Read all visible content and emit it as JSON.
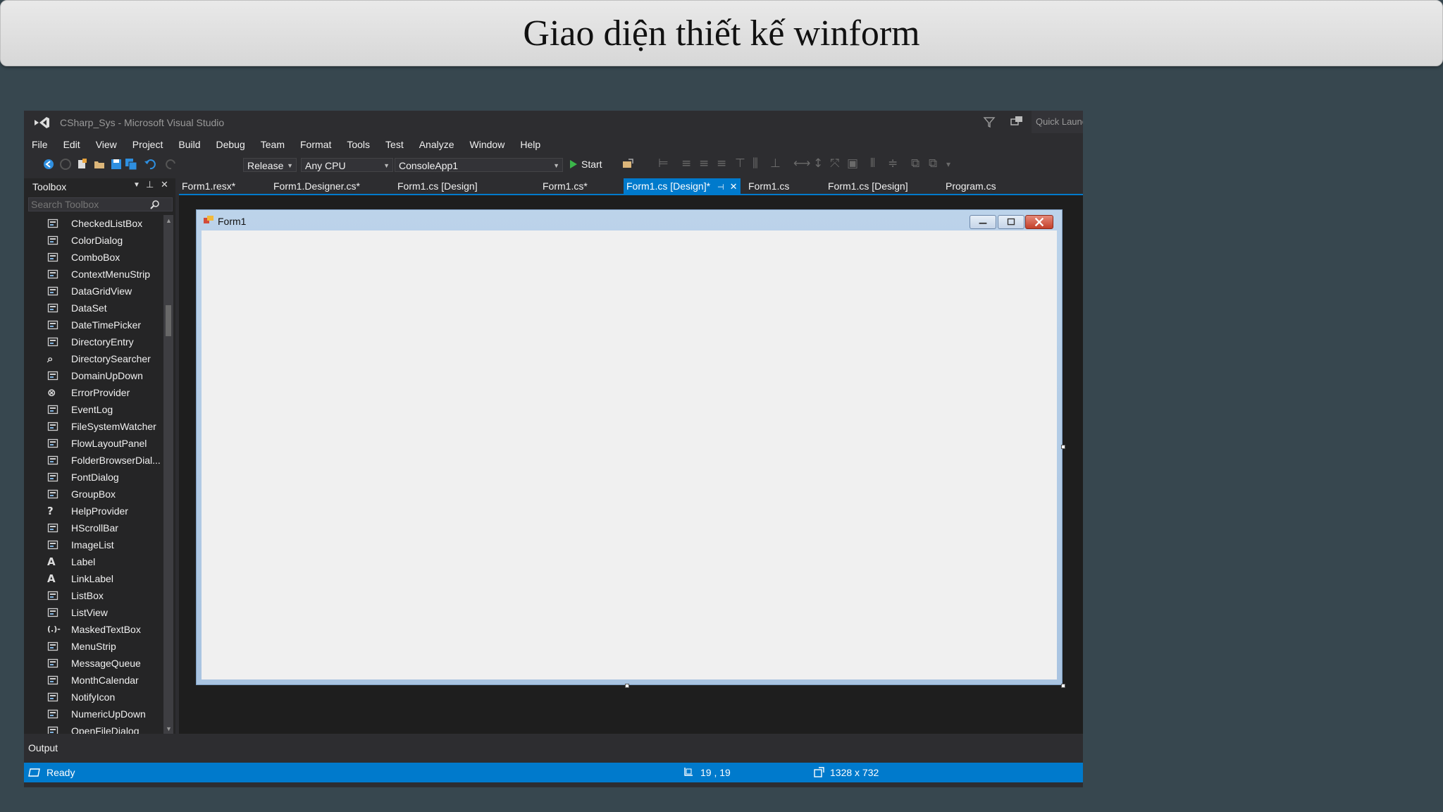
{
  "slide": {
    "title": "Giao diện thiết kế winform"
  },
  "window": {
    "title": "CSharp_Sys - Microsoft Visual Studio",
    "quick_launch": "Quick Launch"
  },
  "menu": [
    "File",
    "Edit",
    "View",
    "Project",
    "Build",
    "Debug",
    "Team",
    "Format",
    "Tools",
    "Test",
    "Analyze",
    "Window",
    "Help"
  ],
  "toolbar": {
    "configuration": "Release",
    "platform": "Any CPU",
    "startup_project": "ConsoleApp1",
    "start_label": "Start"
  },
  "toolbox": {
    "title": "Toolbox",
    "search_placeholder": "Search Toolbox",
    "items": [
      {
        "label": "CheckedListBox",
        "icon": "checkedlistbox-icon"
      },
      {
        "label": "ColorDialog",
        "icon": "colordialog-icon"
      },
      {
        "label": "ComboBox",
        "icon": "combobox-icon"
      },
      {
        "label": "ContextMenuStrip",
        "icon": "contextmenustrip-icon"
      },
      {
        "label": "DataGridView",
        "icon": "datagridview-icon"
      },
      {
        "label": "DataSet",
        "icon": "dataset-icon"
      },
      {
        "label": "DateTimePicker",
        "icon": "datetimepicker-icon"
      },
      {
        "label": "DirectoryEntry",
        "icon": "directoryentry-icon"
      },
      {
        "label": "DirectorySearcher",
        "icon": "directorysearcher-icon"
      },
      {
        "label": "DomainUpDown",
        "icon": "domainupdown-icon"
      },
      {
        "label": "ErrorProvider",
        "icon": "errorprovider-icon"
      },
      {
        "label": "EventLog",
        "icon": "eventlog-icon"
      },
      {
        "label": "FileSystemWatcher",
        "icon": "filesystemwatcher-icon"
      },
      {
        "label": "FlowLayoutPanel",
        "icon": "flowlayoutpanel-icon"
      },
      {
        "label": "FolderBrowserDial...",
        "icon": "folderbrowserdialog-icon"
      },
      {
        "label": "FontDialog",
        "icon": "fontdialog-icon"
      },
      {
        "label": "GroupBox",
        "icon": "groupbox-icon"
      },
      {
        "label": "HelpProvider",
        "icon": "helpprovider-icon"
      },
      {
        "label": "HScrollBar",
        "icon": "hscrollbar-icon"
      },
      {
        "label": "ImageList",
        "icon": "imagelist-icon"
      },
      {
        "label": "Label",
        "icon": "label-icon"
      },
      {
        "label": "LinkLabel",
        "icon": "linklabel-icon"
      },
      {
        "label": "ListBox",
        "icon": "listbox-icon"
      },
      {
        "label": "ListView",
        "icon": "listview-icon"
      },
      {
        "label": "MaskedTextBox",
        "icon": "maskedtextbox-icon"
      },
      {
        "label": "MenuStrip",
        "icon": "menustrip-icon"
      },
      {
        "label": "MessageQueue",
        "icon": "messagequeue-icon"
      },
      {
        "label": "MonthCalendar",
        "icon": "monthcalendar-icon"
      },
      {
        "label": "NotifyIcon",
        "icon": "notifyicon-icon"
      },
      {
        "label": "NumericUpDown",
        "icon": "numericupdown-icon"
      },
      {
        "label": "OpenFileDialog",
        "icon": "openfiledialog-icon"
      }
    ]
  },
  "tabs": [
    {
      "label": "Form1.resx*"
    },
    {
      "label": "Form1.Designer.cs*"
    },
    {
      "label": "Form1.cs [Design]"
    },
    {
      "label": "Form1.cs*"
    },
    {
      "label": "Form1.cs [Design]*",
      "active": true
    },
    {
      "label": "Form1.cs"
    },
    {
      "label": "Form1.cs [Design]"
    },
    {
      "label": "Program.cs"
    }
  ],
  "designer": {
    "form_title": "Form1"
  },
  "output": {
    "label": "Output"
  },
  "status": {
    "ready": "Ready",
    "position": "19 , 19",
    "size": "1328 x 732"
  },
  "colors": {
    "accent": "#007acc",
    "ide_background": "#2d2d30",
    "slide_background": "#37474f"
  }
}
